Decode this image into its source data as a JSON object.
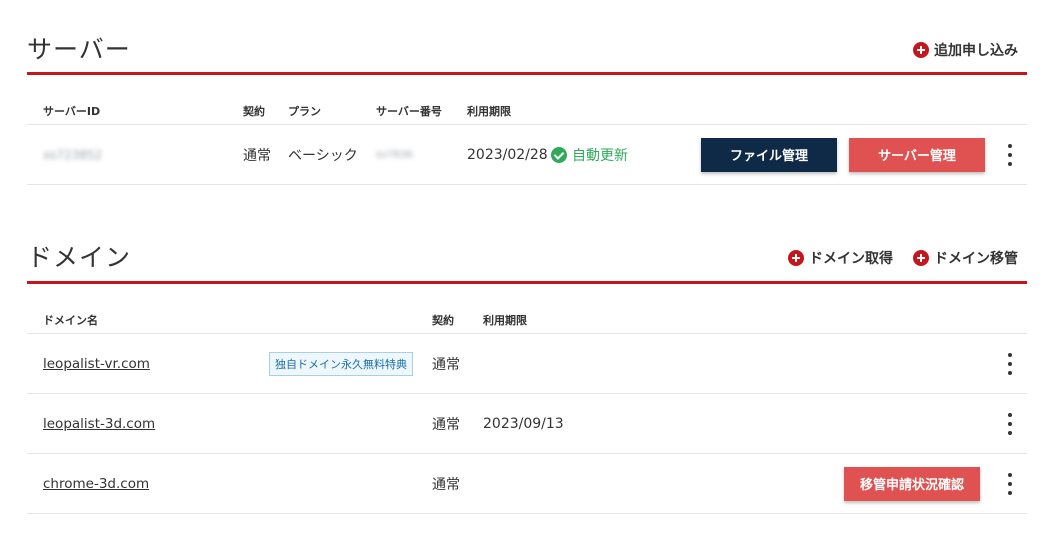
{
  "server": {
    "title": "サーバー",
    "add_label": "追加申し込み",
    "columns": {
      "id": "サーバーID",
      "contract": "契約",
      "plan": "プラン",
      "number": "サーバー番号",
      "expiry": "利用期限"
    },
    "row": {
      "id": "xs723852",
      "contract": "通常",
      "plan": "ベーシック",
      "number": "sv7836",
      "expiry": "2023/02/28",
      "auto_renew": "自動更新",
      "file_button": "ファイル管理",
      "server_button": "サーバー管理"
    }
  },
  "domain": {
    "title": "ドメイン",
    "acquire_label": "ドメイン取得",
    "transfer_label": "ドメイン移管",
    "columns": {
      "name": "ドメイン名",
      "contract": "契約",
      "expiry": "利用期限"
    },
    "rows": [
      {
        "name": "leopalist-vr.com",
        "badge": "独自ドメイン永久無料特典",
        "contract": "通常",
        "expiry": ""
      },
      {
        "name": "leopalist-3d.com",
        "contract": "通常",
        "expiry": "2023/09/13"
      },
      {
        "name": "chrome-3d.com",
        "contract": "通常",
        "expiry": "",
        "action_button": "移管申請状況確認"
      }
    ]
  },
  "colors": {
    "accent_red": "#c4161c",
    "dark_button": "#0e2a47",
    "red_button": "#e05252",
    "success_green": "#2eaa5a"
  }
}
